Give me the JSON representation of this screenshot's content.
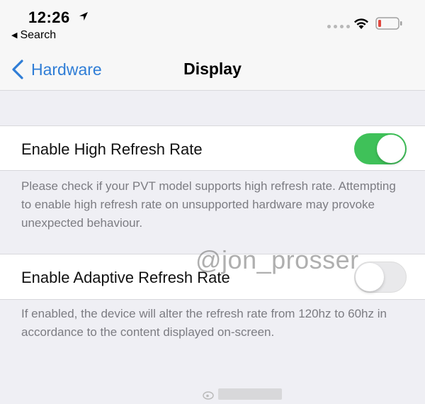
{
  "status_bar": {
    "time": "12:26",
    "back_app_label": "Search",
    "battery_color": "#e0473e"
  },
  "nav": {
    "back_label": "Hardware",
    "title": "Display",
    "accent": "#2f7dd6"
  },
  "settings": [
    {
      "label": "Enable High Refresh Rate",
      "enabled": true,
      "footer": "Please check if your PVT model supports high refresh rate. Attempting to enable high refresh rate on unsupported hardware may provoke unexpected behaviour."
    },
    {
      "label": "Enable Adaptive Refresh Rate",
      "enabled": false,
      "footer": "If enabled, the device will alter the refresh rate from 120hz to 60hz in accordance to the content displayed on-screen."
    }
  ],
  "toggle_on_color": "#3fc159",
  "watermark": "@jon_prosser"
}
